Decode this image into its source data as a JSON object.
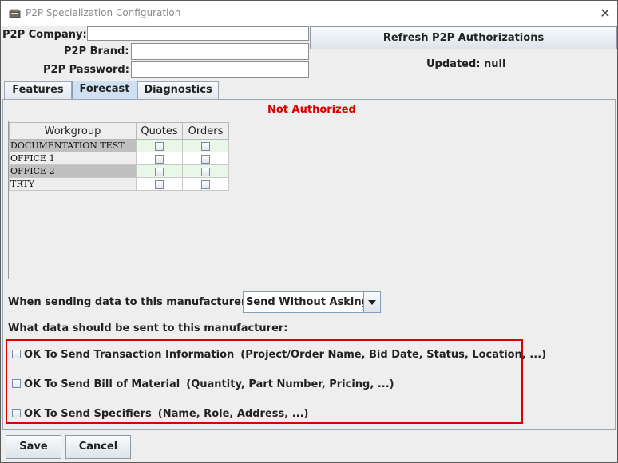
{
  "window": {
    "title": "P2P Specialization Configuration",
    "close_glyph": "✕"
  },
  "credentials": {
    "company_label": "P2P Company:",
    "company_value": "",
    "brand_label": "P2P Brand:",
    "brand_value": "",
    "password_label": "P2P Password:",
    "password_value": ""
  },
  "refresh_button_label": "Refresh P2P Authorizations",
  "updated_text": "Updated: null",
  "tabs": [
    {
      "label": "Features",
      "active": false
    },
    {
      "label": "Forecast",
      "active": true
    },
    {
      "label": "Diagnostics",
      "active": false
    }
  ],
  "forecast": {
    "status_text": "Not Authorized",
    "status_color": "#d60000",
    "columns": [
      "Workgroup",
      "Quotes",
      "Orders"
    ],
    "rows": [
      {
        "workgroup": "DOCUMENTATION TEST",
        "quotes": false,
        "orders": false
      },
      {
        "workgroup": "OFFICE 1",
        "quotes": false,
        "orders": false
      },
      {
        "workgroup": "OFFICE 2",
        "quotes": false,
        "orders": false
      },
      {
        "workgroup": "TRTY",
        "quotes": false,
        "orders": false
      }
    ],
    "send_label": "When sending data to this manufacturer:",
    "send_option": "Send Without Asking",
    "data_question": "What data should be sent to this manufacturer:",
    "options": [
      {
        "label": "OK To Send Transaction Information",
        "detail": "(Project/Order Name, Bid Date, Status, Location, ...)",
        "checked": false
      },
      {
        "label": "OK To Send Bill of Material",
        "detail": "(Quantity, Part Number, Pricing, ...)",
        "checked": false
      },
      {
        "label": "OK To Send Specifiers",
        "detail": "(Name, Role, Address, ...)",
        "checked": false
      }
    ],
    "highlight_color": "#d80000"
  },
  "footer": {
    "save_label": "Save",
    "cancel_label": "Cancel"
  }
}
